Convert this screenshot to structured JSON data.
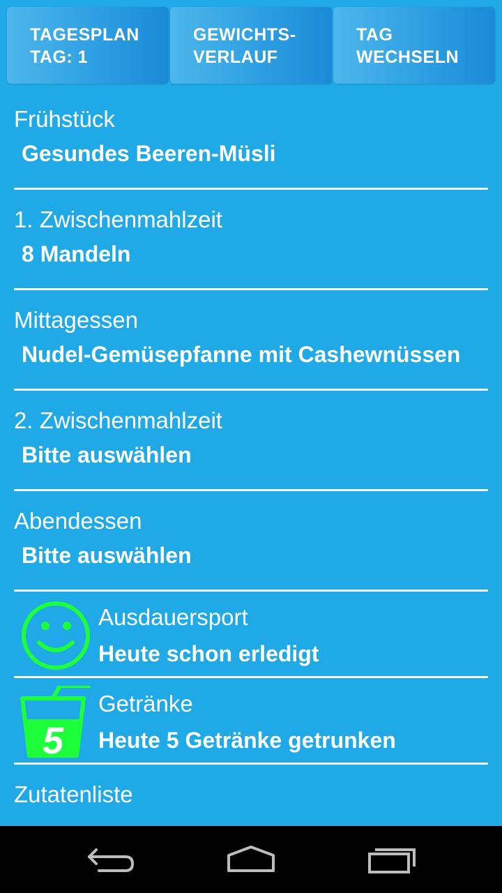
{
  "toolbar": {
    "day_plan": {
      "line1": "TAGESPLAN",
      "line2": "TAG: 1"
    },
    "weight": {
      "line1": "GEWICHTS-",
      "line2": "VERLAUF"
    },
    "change_day": {
      "line1": "TAG",
      "line2": "WECHSELN"
    }
  },
  "meals": [
    {
      "label": "Frühstück",
      "value": "Gesundes Beeren-Müsli"
    },
    {
      "label": "1. Zwischenmahlzeit",
      "value": "8 Mandeln"
    },
    {
      "label": "Mittagessen",
      "value": "Nudel-Gemüsepfanne mit Cashewnüssen"
    },
    {
      "label": "2. Zwischenmahlzeit",
      "value": "Bitte auswählen"
    },
    {
      "label": "Abendessen",
      "value": "Bitte auswählen"
    }
  ],
  "sport": {
    "label": "Ausdauersport",
    "value": "Heute schon erledigt",
    "icon": "smiley-icon",
    "color": "#1cff3a"
  },
  "drinks": {
    "label": "Getränke",
    "value": "Heute 5 Getränke getrunken",
    "icon": "drink-glass-icon",
    "count": "5",
    "color": "#1cff3a"
  },
  "ingredients": {
    "label": "Zutatenliste"
  },
  "navigation": {
    "back": "back-icon",
    "home": "home-icon",
    "recents": "recent-apps-icon"
  },
  "colors": {
    "background": "#1fa9e6",
    "accent": "#1cff3a",
    "navbar": "#000000"
  }
}
